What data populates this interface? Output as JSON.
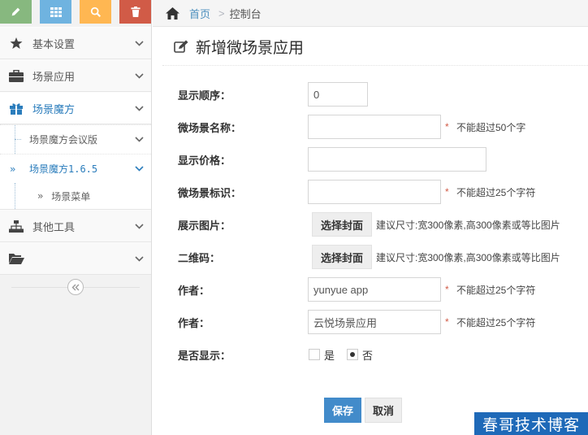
{
  "shortcuts": [
    {
      "icon": "pencil-icon",
      "color": "#87b87f"
    },
    {
      "icon": "grid-icon",
      "color": "#6fb3e0"
    },
    {
      "icon": "zoom-icon",
      "color": "#ffb752"
    },
    {
      "icon": "trash-icon",
      "color": "#d15b47"
    }
  ],
  "sidebar": {
    "items": [
      {
        "label": "基本设置",
        "icon": "star-icon"
      },
      {
        "label": "场景应用",
        "icon": "briefcase-icon"
      },
      {
        "label": "场景魔方",
        "icon": "gift-icon"
      },
      {
        "label": "其他工具",
        "icon": "sitemap-icon"
      },
      {
        "label": "",
        "icon": "folder-open-icon"
      }
    ],
    "sub_items": [
      {
        "label": "场景魔方会议版"
      },
      {
        "label": "场景魔方1.6.5",
        "marker": "»"
      }
    ],
    "sub_sub_items": [
      {
        "label": "场景菜单",
        "marker": "»"
      }
    ],
    "collapse_icon": "double-chevron-left-icon"
  },
  "breadcrumb": {
    "home_label": "首页",
    "separator": ">",
    "current": "控制台"
  },
  "page": {
    "title": "新增微场景应用"
  },
  "form": {
    "order": {
      "label": "显示顺序：",
      "value": "0"
    },
    "name": {
      "label": "微场景名称：",
      "value": "",
      "hint": "不能超过50个字"
    },
    "price": {
      "label": "显示价格：",
      "value": ""
    },
    "ident": {
      "label": "微场景标识：",
      "value": "",
      "hint": "不能超过25个字符"
    },
    "image": {
      "label": "展示图片：",
      "button": "选择封面",
      "hint": "建议尺寸:宽300像素,高300像素或等比图片"
    },
    "qrcode": {
      "label": "二维码：",
      "button": "选择封面",
      "hint": "建议尺寸:宽300像素,高300像素或等比图片"
    },
    "author1": {
      "label": "作者：",
      "value": "yunyue app",
      "hint": "不能超过25个字符"
    },
    "author2": {
      "label": "作者：",
      "value": "云悦场景应用",
      "hint": "不能超过25个字符"
    },
    "show": {
      "label": "是否显示：",
      "yes": "是",
      "no": "否",
      "selected": "否"
    },
    "required_mark": "*"
  },
  "actions": {
    "save": "保存",
    "cancel": "取消"
  },
  "watermark": "春哥技术博客"
}
